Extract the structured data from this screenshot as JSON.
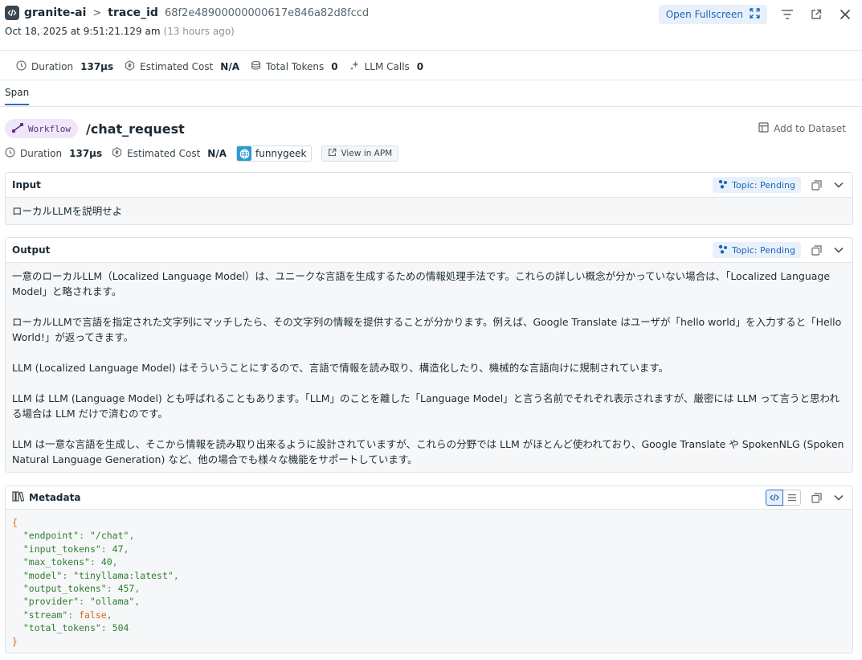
{
  "header": {
    "app_name": "granite-ai",
    "separator": ">",
    "trace_label": "trace_id",
    "trace_id": "68f2e48900000000617e846a82d8fccd",
    "timestamp": "Oct 18, 2025 at 9:51:21.129 am",
    "relative_time": "(13 hours ago)",
    "open_fullscreen_label": "Open Fullscreen"
  },
  "summary": {
    "duration_label": "Duration",
    "duration_value": "137µs",
    "cost_label": "Estimated Cost",
    "cost_value": "N/A",
    "tokens_label": "Total Tokens",
    "tokens_value": "0",
    "llm_calls_label": "LLM Calls",
    "llm_calls_value": "0"
  },
  "tabs": [
    {
      "label": "Span",
      "active": true
    }
  ],
  "span": {
    "kind": "Workflow",
    "name": "/chat_request",
    "add_dataset_label": "Add to Dataset",
    "duration_label": "Duration",
    "duration_value": "137µs",
    "cost_label": "Estimated Cost",
    "cost_value": "N/A",
    "user": "funnygeek",
    "apm_label": "View in APM"
  },
  "input_panel": {
    "title": "Input",
    "topic_label": "Topic: Pending",
    "text": "ローカルLLMを説明せよ"
  },
  "output_panel": {
    "title": "Output",
    "topic_label": "Topic: Pending",
    "paragraphs": [
      "一意のローカルLLM（Localized Language Model）は、ユニークな言語を生成するための情報処理手法です。これらの詳しい概念が分かっていない場合は、「Localized Language Model」と略されます。",
      "ローカルLLMで言語を指定された文字列にマッチしたら、その文字列の情報を提供することが分かります。例えば、Google Translate はユーザが「hello world」を入力すると「Hello World!」が返ってきます。",
      "LLM (Localized Language Model) はそういうことにするので、言語で情報を読み取り、構造化したり、機械的な言語向けに規制されています。",
      "LLM は LLM (Language Model) とも呼ばれることもあります。「LLM」のことを離した「Language Model」と言う名前でそれぞれ表示されますが、厳密には LLM って言うと思われる場合は LLM だけで済むのです。",
      "LLM は一意な言語を生成し、そこから情報を読み取り出来るように設計されていますが、これらの分野では LLM がほとんど使われており、Google Translate や SpokenNLG (Spoken Natural Language Generation) など、他の場合でも様々な機能をサポートしています。"
    ]
  },
  "metadata_panel": {
    "title": "Metadata",
    "open_brace": "{",
    "close_brace": "}",
    "entries": [
      {
        "key": "\"endpoint\"",
        "value": "\"/chat\"",
        "type": "str"
      },
      {
        "key": "\"input_tokens\"",
        "value": "47",
        "type": "num"
      },
      {
        "key": "\"max_tokens\"",
        "value": "40",
        "type": "num"
      },
      {
        "key": "\"model\"",
        "value": "\"tinyllama:latest\"",
        "type": "str"
      },
      {
        "key": "\"output_tokens\"",
        "value": "457",
        "type": "num"
      },
      {
        "key": "\"provider\"",
        "value": "\"ollama\"",
        "type": "str"
      },
      {
        "key": "\"stream\"",
        "value": "false",
        "type": "bool"
      },
      {
        "key": "\"total_tokens\"",
        "value": "504",
        "type": "num"
      }
    ]
  },
  "colors": {
    "accent": "#2d6fc0",
    "badge_bg": "#e8f1fb",
    "workflow_bg": "#efe7f7",
    "workflow_fg": "#5a2d8a",
    "json_key": "#2e7d32",
    "json_brace": "#d9631e"
  },
  "icons": {
    "app": "code-icon",
    "fullscreen": "expand-icon",
    "filter": "filter-icon",
    "external": "external-link-icon",
    "close": "close-icon",
    "duration": "clock-icon",
    "cost": "coin-icon",
    "tokens": "database-icon",
    "llm_calls": "sparkle-icon",
    "workflow": "workflow-icon",
    "dataset": "table-icon",
    "user": "globe-icon",
    "apm": "external-link-icon",
    "topic": "topic-cluster-icon",
    "copy": "copy-icon",
    "collapse": "chevron-down-icon",
    "metadata": "books-icon",
    "code_view": "code-icon",
    "list_view": "list-icon"
  }
}
